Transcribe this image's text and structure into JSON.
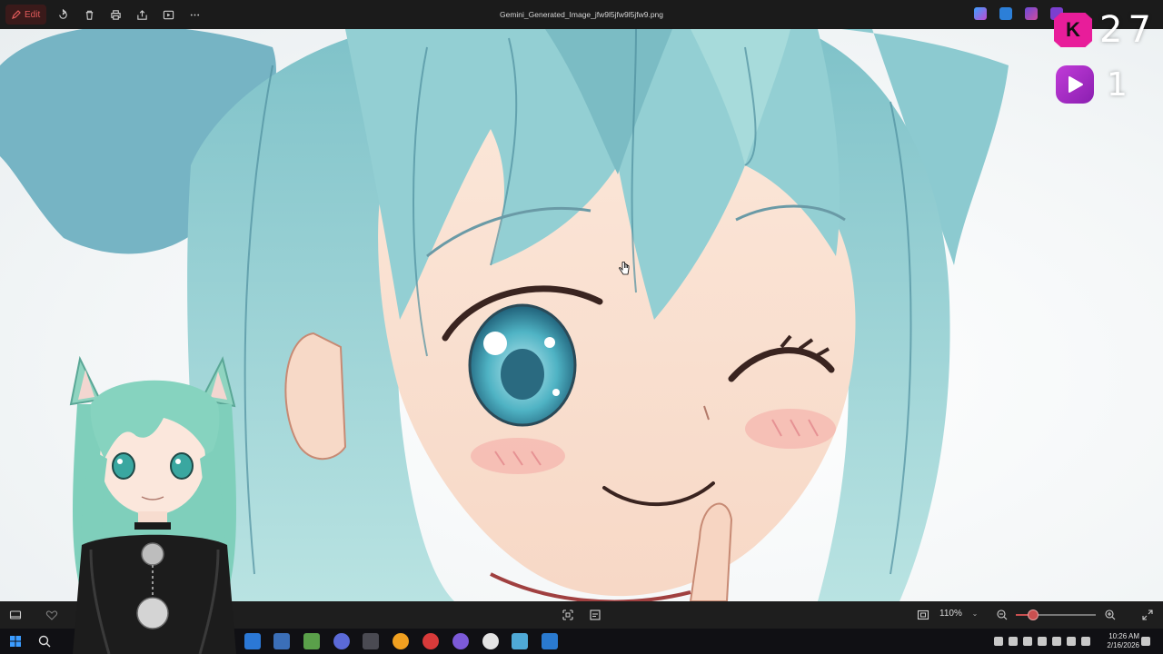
{
  "titlebar": {
    "edit_label": "Edit",
    "title": "Gemini_Generated_Image_jfw9l5jfw9l5jfw9.png"
  },
  "overlay": {
    "k_count": "27",
    "k_badge": "K",
    "play_count": "1"
  },
  "statusbar": {
    "zoom_label": "110%",
    "zoom_level": 0.2
  },
  "taskbar": {
    "time": "10:26 AM",
    "date": "2/16/2026"
  },
  "colors": {
    "accent": "#c95050",
    "k_badge": "#e81d9a",
    "play_badge": "#a52ccb",
    "hair": "#9fd3d4"
  },
  "icons": {
    "top": [
      "pen-icon",
      "rotate-icon",
      "delete-icon",
      "print-icon",
      "share-icon",
      "slideshow-icon",
      "more-icon"
    ],
    "bottom": [
      "filmstrip-icon",
      "favorite-icon",
      "crop-icon",
      "select-icon",
      "fit-icon",
      "zoom-out-icon",
      "zoom-in-icon",
      "fullscreen-icon"
    ]
  }
}
